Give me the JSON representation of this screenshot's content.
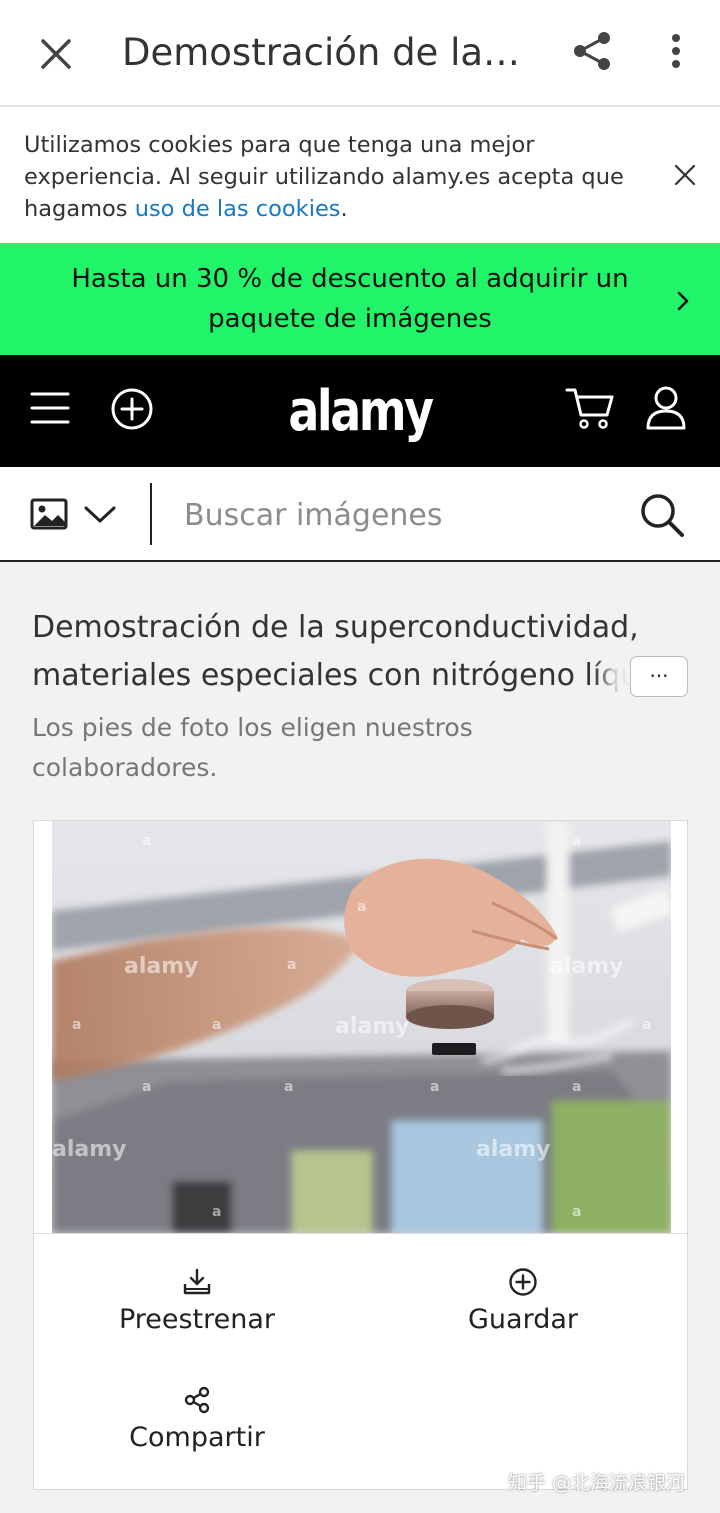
{
  "topbar": {
    "title": "Demostración de la…",
    "icons": {
      "close": "close-icon",
      "share": "share-icon",
      "more": "more-vertical-icon"
    }
  },
  "cookie_banner": {
    "text_before": "Utilizamos cookies para que tenga una mejor experiencia. Al seguir utilizando alamy.es acepta que hagamos ",
    "link_text": "uso de las cookies",
    "text_after": ".",
    "link_color": "#1a78c2"
  },
  "promo": {
    "text": "Hasta un 30 % de descuento al adquirir un paquete de imágenes",
    "background": "#22f46a"
  },
  "nav": {
    "logo": "alamy",
    "icons": [
      "menu-icon",
      "add-circle-icon",
      "cart-icon",
      "user-icon"
    ]
  },
  "search": {
    "placeholder": "Buscar imágenes",
    "type_icon": "image-icon"
  },
  "main": {
    "title": "Demostración de la superconductividad, materiales especiales con nitrógeno líquido",
    "more_label": "···",
    "caption_note": "Los pies de foto los eligen nuestros colaboradores."
  },
  "photo": {
    "watermark": "alamy",
    "watermark_small": "a"
  },
  "actions": {
    "preview": "Preestrenar",
    "save": "Guardar",
    "share": "Compartir"
  },
  "footer_watermark": "知乎 @北海流浪银河"
}
